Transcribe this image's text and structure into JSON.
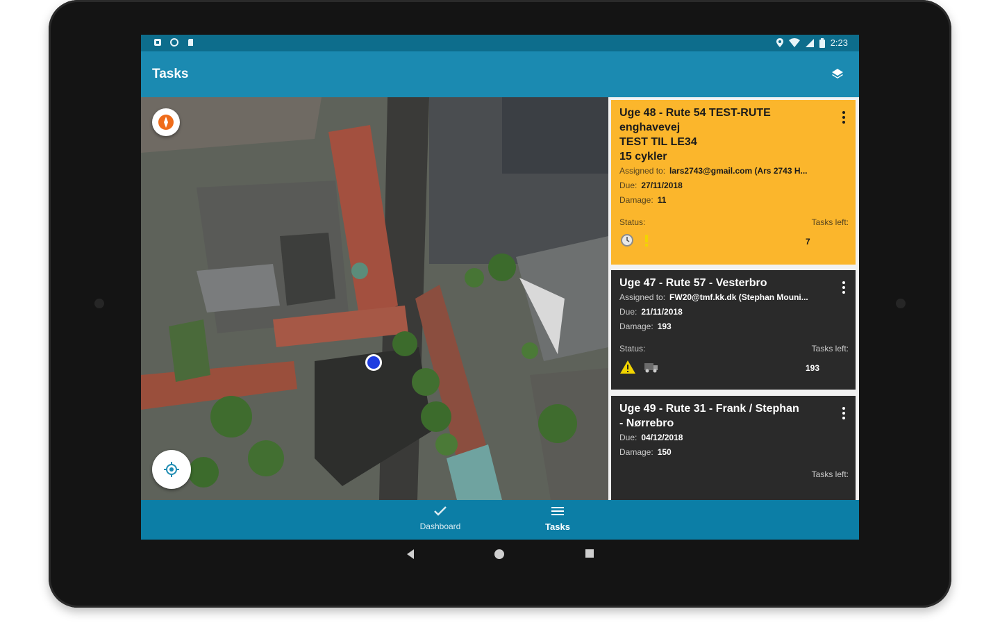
{
  "status_bar": {
    "time": "2:23"
  },
  "app_bar": {
    "title": "Tasks",
    "layers_icon": "layers-icon"
  },
  "map": {
    "compass_icon": "compass-icon",
    "locate_icon": "my-location-icon"
  },
  "tasks": [
    {
      "title": "Uge 48 - Rute 54 TEST-RUTE\nenghavevej\nTEST TIL LE34\n15 cykler",
      "assigned_label": "Assigned to:",
      "assigned_value": "lars2743@gmail.com (Ars 2743 H...",
      "due_label": "Due:",
      "due_value": "27/11/2018",
      "damage_label": "Damage:",
      "damage_value": "11",
      "status_label": "Status:",
      "tasks_left_label": "Tasks left:",
      "tasks_left_value": "7",
      "status_icons": [
        "clock-icon",
        "warning-icon"
      ],
      "color": "#fbb62c"
    },
    {
      "title": "Uge 47 - Rute 57 - Vesterbro",
      "assigned_label": "Assigned to:",
      "assigned_value": "FW20@tmf.kk.dk (Stephan Mouni...",
      "due_label": "Due:",
      "due_value": "21/11/2018",
      "damage_label": "Damage:",
      "damage_value": "193",
      "status_label": "Status:",
      "tasks_left_label": "Tasks left:",
      "tasks_left_value": "193",
      "status_icons": [
        "warning-icon",
        "truck-icon"
      ],
      "color": "#2a2a2a"
    },
    {
      "title": "Uge 49 - Rute 31 - Frank / Stephan\n- Nørrebro",
      "due_label": "Due:",
      "due_value": "04/12/2018",
      "damage_label": "Damage:",
      "damage_value": "150",
      "tasks_left_label": "Tasks left:",
      "color": "#2a2a2a"
    }
  ],
  "bottom_nav": {
    "dashboard_label": "Dashboard",
    "tasks_label": "Tasks",
    "color": "#0c7ea6"
  }
}
